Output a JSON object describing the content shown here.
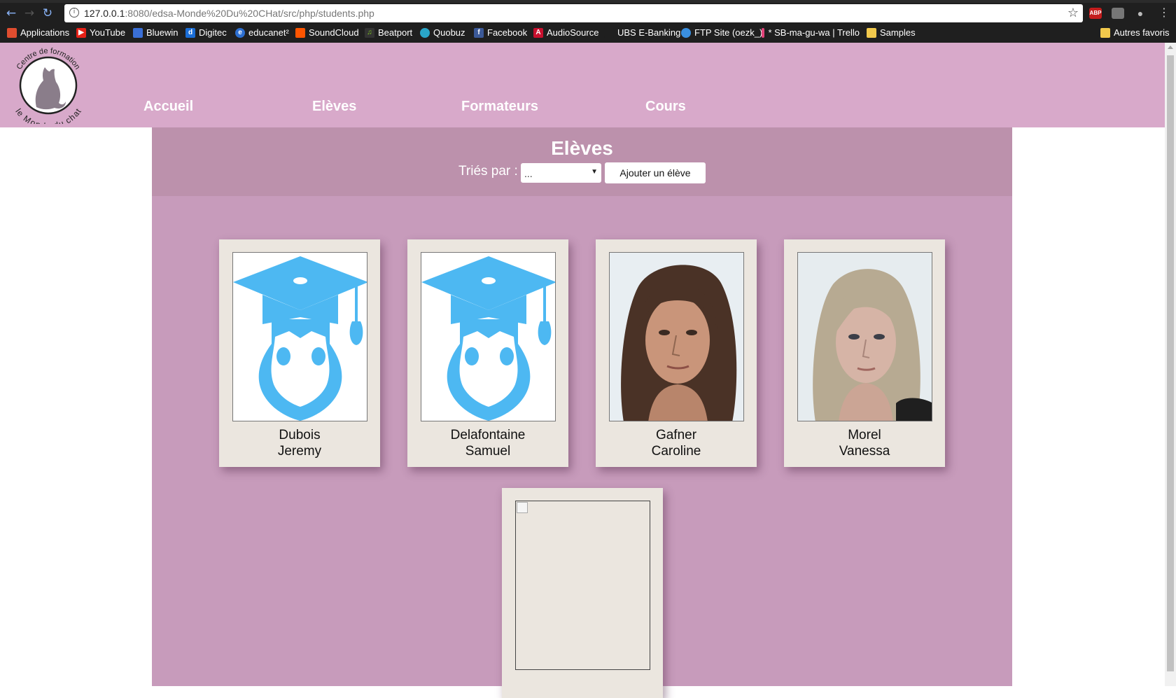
{
  "browser": {
    "url_host": "127.0.0.1",
    "url_rest": ":8080/edsa-Monde%20Du%20CHat/src/php/students.php",
    "extension_abp": "ABP",
    "bookmarks": [
      {
        "label": "Applications",
        "icon": "apps-grid-icon",
        "color": "#e04d2f"
      },
      {
        "label": "YouTube",
        "icon": "youtube-icon",
        "color": "#e62117"
      },
      {
        "label": "Bluewin",
        "icon": "bluewin-icon",
        "color": "#3a6fd6"
      },
      {
        "label": "Digitec",
        "icon": "digitec-icon",
        "color": "#1a6dd6"
      },
      {
        "label": "educanet²",
        "icon": "educanet-icon",
        "color": "#2d6fd1"
      },
      {
        "label": "SoundCloud",
        "icon": "soundcloud-icon",
        "color": "#ff5500"
      },
      {
        "label": "Beatport",
        "icon": "beatport-icon",
        "color": "#7ec81e"
      },
      {
        "label": "Quobuz",
        "icon": "qobuz-icon",
        "color": "#2aa6c9"
      },
      {
        "label": "Facebook",
        "icon": "facebook-icon",
        "color": "#3b5998"
      },
      {
        "label": "AudioSource",
        "icon": "audiosource-icon",
        "color": "#c8102e"
      },
      {
        "label": "UBS E-Banking",
        "icon": "ubs-icon",
        "color": "#1f1f1f"
      },
      {
        "label": "FTP Site (oezk_)",
        "icon": "ftp-icon",
        "color": "#3a8fe0"
      },
      {
        "label": "* SB-ma-gu-wa | Trello",
        "icon": "trello-icon",
        "color": "#e3447a"
      },
      {
        "label": "Samples",
        "icon": "folder-icon",
        "color": "#f2c94c"
      },
      {
        "label": "Autres favoris",
        "icon": "folder-icon",
        "color": "#f2c94c"
      }
    ]
  },
  "logo": {
    "top_text": "Centre de formation",
    "bottom_text": "le Monde du chat"
  },
  "nav": {
    "accueil": "Accueil",
    "eleves": "Elèves",
    "formateurs": "Formateurs",
    "cours": "Cours"
  },
  "page": {
    "title": "Elèves",
    "sort_label": "Triés par :",
    "sort_value": "...",
    "add_button": "Ajouter un élève"
  },
  "students": [
    {
      "last": "Dubois",
      "first": "Jeremy",
      "photo": "graduate-avatar"
    },
    {
      "last": "Delafontaine",
      "first": "Samuel",
      "photo": "graduate-avatar"
    },
    {
      "last": "Gafner",
      "first": "Caroline",
      "photo": "portrait-photo"
    },
    {
      "last": "Morel",
      "first": "Vanessa",
      "photo": "portrait-photo"
    },
    {
      "last": "",
      "first": "",
      "photo": "broken-image"
    }
  ],
  "colors": {
    "header": "#d8a9ca",
    "content": "#c79bbb",
    "content_head": "#bc91ac",
    "card": "#ebe6df",
    "avatar_blue": "#4db8f2"
  }
}
